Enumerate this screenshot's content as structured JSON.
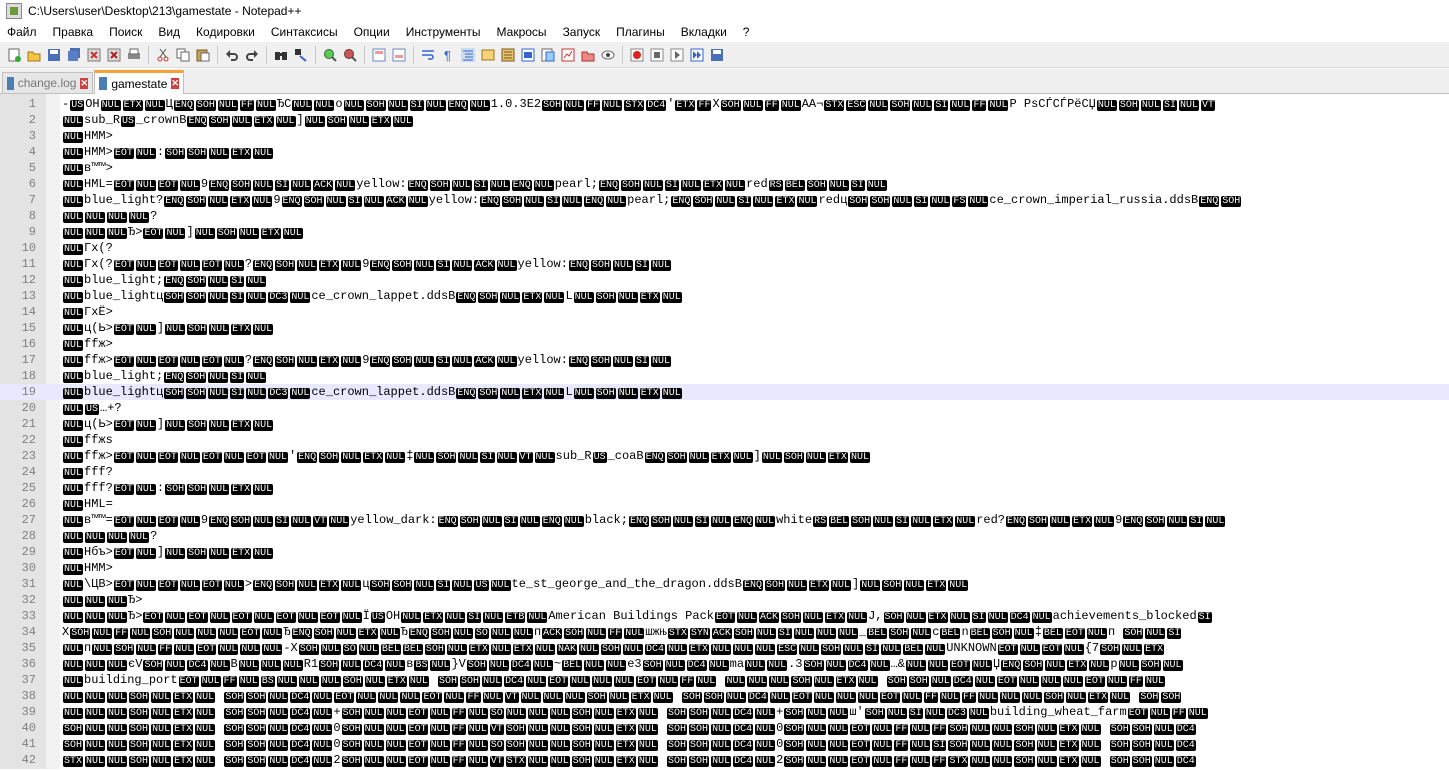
{
  "window": {
    "title": "C:\\Users\\user\\Desktop\\213\\gamestate - Notepad++"
  },
  "menu": [
    "Файл",
    "Правка",
    "Поиск",
    "Вид",
    "Кодировки",
    "Синтаксисы",
    "Опции",
    "Инструменты",
    "Макросы",
    "Запуск",
    "Плагины",
    "Вкладки",
    "?"
  ],
  "tabs": [
    {
      "label": "change.log",
      "active": false
    },
    {
      "label": "gamestate",
      "active": true
    }
  ],
  "colors": {
    "accent_tab": "#f9a23b",
    "current_line": "#e8e8ff",
    "control_char_bg": "#000000"
  },
  "editor": {
    "current_line": 19,
    "lines": [
      "-USOHNULETXNULЦENQSOHNULFFNULЂCNULNULoNULSOHNULSINULENQNUL1.0.3E2SOHNULFFNULSTXDC4'ETXFFXSOHNULFFNULAA¬STXESCNULSOHNULSINULFFNULP PsСЃСЃРёСЏNULSOHNULSINULVT",
      "NULsub_RUS_crownBENQSOHNULETXNUL]NULSOHNULETXNUL",
      "NULHMM>",
      "NULHMM>EOTNUL:SOHSOHNULETXNUL",
      "NULв™™>",
      "NULHML=EOTNULEOTNUL9ENQSOHNULSINULACKNULyellow:ENQSOHNULSINULENQNULpearl;ENQSOHNULSINULETXNULredRSBELSOHNULSINUL",
      "NULblue_light?ENQSOHNULETXNUL9ENQSOHNULSINULACKNULyellow:ENQSOHNULSINULENQNULpearl;ENQSOHNULSINULETXNULredцSOHSOHNULSINULFSNULce_crown_imperial_russia.ddsBENQSOH",
      "NULNULNULNUL?",
      "NULNULNULЂ>EOTNUL]NULSOHNULETXNUL",
      "NULГх(?",
      "NULГх(?EOTNULEOTNULEOTNUL?ENQSOHNULETXNUL9ENQSOHNULSINULACKNULyellow:ENQSOHNULSINUL",
      "NULblue_light;ENQSOHNULSINUL",
      "NULblue_lightцSOHSOHNULSINULDC3NULce_crown_lappet.ddsBENQSOHNULETXNULLNULSOHNULETXNUL",
      "NULГхЁ>",
      "NULц(Ь>EOTNUL]NULSOHNULETXNUL",
      "NULffж>",
      "NULffж>EOTNULEOTNULEOTNUL?ENQSOHNULETXNUL9ENQSOHNULSINULACKNULyellow:ENQSOHNULSINUL",
      "NULblue_light;ENQSOHNULSINUL",
      "NULblue_lightцSOHSOHNULSINULDC3NULce_crown_lappet.ddsBENQSOHNULETXNULLNULSOHNULETXNUL",
      "NULUS…+?",
      "NULц(Ь>EOTNUL]NULSOHNULETXNUL",
      "NULffжs",
      "NULffж>EOTNULEOTNULEOTNULEOTNUL'ENQSOHNULETXNUL‡NULSOHNULSINULVTNULsub_RUS_coaBENQSOHNULETXNUL]NULSOHNULETXNUL",
      "NULfff?",
      "NULfff?EOTNUL:SOHSOHNULETXNUL",
      "NULHML=",
      "NULв™™=EOTNULEOTNUL9ENQSOHNULSINULVTNULyellow_dark:ENQSOHNULSINULENQNULblack;ENQSOHNULSINULENQNULwhiteRSBELSOHNULSINULETXNULred?ENQSOHNULETXNUL9ENQSOHNULSINUL",
      "NULNULNULNUL?",
      "NULНбъ>EOTNUL]NULSOHNULETXNUL",
      "NULHMM>",
      "NUL\\ЦВ>EOTNULEOTNULEOTNUL>ENQSOHNULETXNULцSOHSOHNULSINULUSNULte_st_george_and_the_dragon.ddsBENQSOHNULETXNUL]NULSOHNULETXNUL",
      "NULNULNULЂ>",
      "NULNULNULЂ>EOTNULEOTNULEOTNULEOTNULEOTNULЇUSOHNULETXNULSINULETBNULAmerican Buildings PackEOTNULACKSOHNULETXNULJ,SOHNULETXNULSINULDC4NULachievements_blockedSI",
      "XSOHNULFFNULSOHNULNULNULEOTNULЂENQSOHNULETXNULЂENQSOHNULSONULNULпACKSOHNULFFNULшжњSTXSYNACKSOHNULSINULNULNUL_BELSOHNULcBELnBELSOHNUL‡BELEOTNULп    SOHNULSI",
      "NULпNULSOHNULFFNULEOTNULNULNUL-XSOHNULSONULBELBELSOHNULETXNULETXNULNAKNULSOHNULDC4NULETXNULNULNULESCNULSOHNULSINULBELNULUNKNOWNEOTNULEOTNUL{7SOHNULETX",
      "NULNULNULєVSOHNULDC4NULBNULNULNULR1SOHNULDC4NULвBSNUL}VSOHNULDC4NUL~BELNULNULe3SOHNULDC4NULmaNULNUL.3SOHNULDC4NUL…&NULNULEOTNULЏENQSOHNULETXNULрNULSOHNUL",
      "NULbuilding_portEOTNULFFNULBSNULNULNULSOHNULETXNUL SOHSOHNULDC4NULEOTNULNULNULEOTNULFFNUL NULNULNULSOHNULETXNUL SOHSOHNULDC4NULEOTNULNULNULEOTNULFFNUL",
      "NULNULNULSOHNULETXNUL SOHSOHNULDC4NULEOTNULNULNULEOTNULFFNULVTNULNULNULSOHNULETXNUL SOHSOHNULDC4NULEOTNULNULNULEOTNULFFNULFFNULNULNULSOHNULETXNUL SOHSOH",
      "NULNULNULSOHNULETXNUL SOHSOHNULDC4NUL+SOHNULNULEOTNULFFNULSONULNULNULSOHNULETXNUL SOHSOHNULDC4NUL+SOHNULNULш'SOHNULSINULDC3NULbuilding_wheat_farmEOTNULFFNUL",
      "SOHNULNULSOHNULETXNUL SOHSOHNULDC4NUL0SOHNULNULEOTNULFFNULVTSOHNULNULSOHNULETXNUL SOHSOHNULDC4NUL0SOHNULNULEOTNULFFNULFFSOHNULNULSOHNULETXNUL SOHSOHNULDC4",
      "SOHNULNULSOHNULETXNUL SOHSOHNULDC4NUL0SOHNULNULEOTNULFFNULSOSOHNULNULSOHNULETXNUL SOHSOHNULDC4NUL0SOHNULNULEOTNULFFNULSISOHNULNULSOHNULETXNUL SOHSOHNULDC4",
      "STXNULNULSOHNULETXNUL SOHSOHNULDC4NUL2SOHNULNULEOTNULFFNULVTSTXNULNULSOHNULETXNUL SOHSOHNULDC4NUL2SOHNULNULEOTNULFFNULFFSTXNULNULSOHNULETXNUL SOHSOHNULDC4"
    ]
  }
}
